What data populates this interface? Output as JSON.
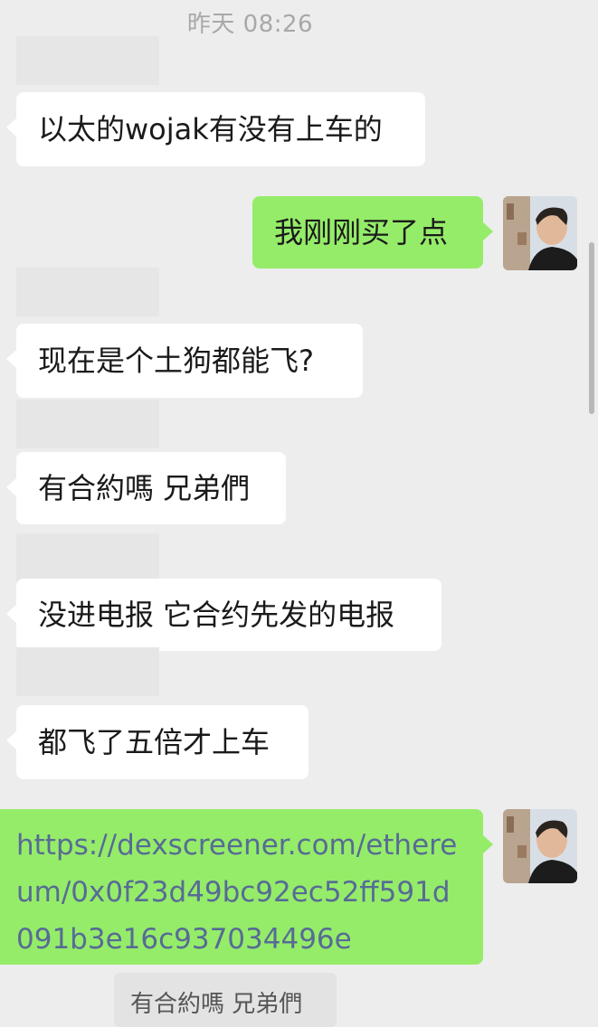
{
  "timestamp": "昨天 08:26",
  "messages": [
    {
      "side": "left",
      "text": "以太的wojak有没有上车的"
    },
    {
      "side": "right",
      "text": "我刚刚买了点"
    },
    {
      "side": "left",
      "text": "现在是个土狗都能飞?"
    },
    {
      "side": "left",
      "text": "有合約嗎 兄弟們"
    },
    {
      "side": "left",
      "text": "没进电报 它合约先发的电报"
    },
    {
      "side": "left",
      "text": "都飞了五倍才上车"
    },
    {
      "side": "right",
      "text": "https://dexscreener.com/ethereum/0x0f23d49bc92ec52ff591d091b3e16c937034496e"
    }
  ],
  "quote": {
    "text": "有合約嗎 兄弟們"
  },
  "colors": {
    "background": "#ededed",
    "incoming_bubble": "#ffffff",
    "outgoing_bubble": "#95ec69",
    "link": "#576b95"
  },
  "icons": {
    "self_avatar": "user-avatar-photo"
  }
}
